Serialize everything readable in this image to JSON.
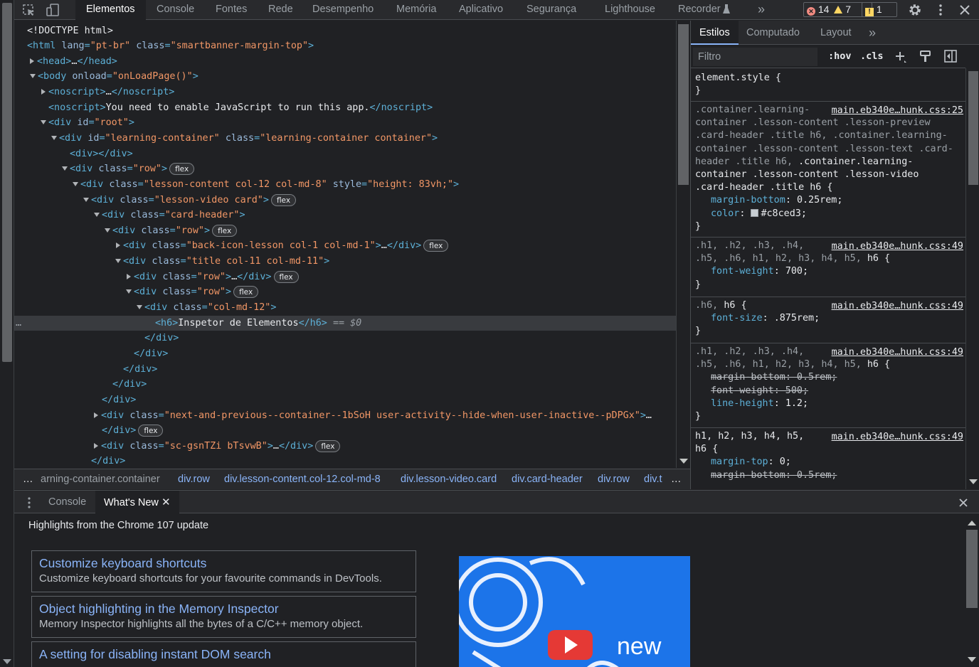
{
  "toolbar": {
    "tabs": [
      "Elementos",
      "Console",
      "Fontes",
      "Rede",
      "Desempenho",
      "Memória",
      "Aplicativo",
      "Segurança",
      "Lighthouse",
      "Recorder"
    ],
    "more": "»",
    "errors": "14",
    "warnings": "7",
    "issues": "1"
  },
  "dom": {
    "lines": [
      {
        "html": "<span class='tx'>&lt;!DOCTYPE html&gt;</span>"
      },
      {
        "html": "<span class='tag'>&lt;html</span> <span class='an'>lang</span><span class='tag'>=</span><span class='av'>\"pt-br\"</span> <span class='an'>class</span><span class='tag'>=</span><span class='av'>\"smartbanner-margin-top\"</span><span class='tag'>&gt;</span>"
      },
      {
        "html": "<span class='tag'>&lt;head&gt;</span><span class='tx'>…</span><span class='tag'>&lt;/head&gt;</span>"
      },
      {
        "html": "<span class='tag'>&lt;body</span> <span class='an'>onload</span><span class='tag'>=</span><span class='av'>\"onLoadPage()\"</span><span class='tag'>&gt;</span>"
      },
      {
        "html": "<span class='tag'>&lt;noscript&gt;</span><span class='tx'>…</span><span class='tag'>&lt;/noscript&gt;</span>"
      },
      {
        "html": "<span class='tag'>&lt;noscript&gt;</span><span class='tx'>You need to enable JavaScript to run this app.</span><span class='tag'>&lt;/noscript&gt;</span>"
      },
      {
        "html": "<span class='tag'>&lt;div</span> <span class='an'>id</span><span class='tag'>=</span><span class='av'>\"root\"</span><span class='tag'>&gt;</span>"
      },
      {
        "html": "<span class='tag'>&lt;div</span> <span class='an'>id</span><span class='tag'>=</span><span class='av'>\"learning-container\"</span> <span class='an'>class</span><span class='tag'>=</span><span class='av'>\"learning-container container\"</span><span class='tag'>&gt;</span>"
      },
      {
        "html": "<span class='tag'>&lt;div&gt;&lt;/div&gt;</span>"
      },
      {
        "html": "<span class='tag'>&lt;div</span> <span class='an'>class</span><span class='tag'>=</span><span class='av'>\"row\"</span><span class='tag'>&gt;</span>"
      },
      {
        "html": "<span class='tag'>&lt;div</span> <span class='an'>class</span><span class='tag'>=</span><span class='av'>\"lesson-content col-12 col-md-8\"</span> <span class='an'>style</span><span class='tag'>=</span><span class='av'>\"height: 83vh;\"</span><span class='tag'>&gt;</span>"
      },
      {
        "html": "<span class='tag'>&lt;div</span> <span class='an'>class</span><span class='tag'>=</span><span class='av'>\"lesson-video card\"</span><span class='tag'>&gt;</span>"
      },
      {
        "html": "<span class='tag'>&lt;div</span> <span class='an'>class</span><span class='tag'>=</span><span class='av'>\"card-header\"</span><span class='tag'>&gt;</span>"
      },
      {
        "html": "<span class='tag'>&lt;div</span> <span class='an'>class</span><span class='tag'>=</span><span class='av'>\"row\"</span><span class='tag'>&gt;</span>"
      },
      {
        "html": "<span class='tag'>&lt;div</span> <span class='an'>class</span><span class='tag'>=</span><span class='av'>\"back-icon-lesson col-1 col-md-1\"</span><span class='tag'>&gt;</span><span class='tx'>…</span><span class='tag'>&lt;/div&gt;</span>"
      },
      {
        "html": "<span class='tag'>&lt;div</span> <span class='an'>class</span><span class='tag'>=</span><span class='av'>\"title col-11 col-md-11\"</span><span class='tag'>&gt;</span>"
      },
      {
        "html": "<span class='tag'>&lt;div</span> <span class='an'>class</span><span class='tag'>=</span><span class='av'>\"row\"</span><span class='tag'>&gt;</span><span class='tx'>…</span><span class='tag'>&lt;/div&gt;</span>"
      },
      {
        "html": "<span class='tag'>&lt;div</span> <span class='an'>class</span><span class='tag'>=</span><span class='av'>\"row\"</span><span class='tag'>&gt;</span>"
      },
      {
        "html": "<span class='tag'>&lt;div</span> <span class='an'>class</span><span class='tag'>=</span><span class='av'>\"col-md-12\"</span><span class='tag'>&gt;</span>"
      },
      {
        "html": "<span class='tag'>&lt;h6&gt;</span><span class='tx'>Inspetor de Elementos</span><span class='tag'>&lt;/h6&gt;</span> <span class='dim'>== <i>$0</i></span>"
      },
      {
        "html": "<span class='tag'>&lt;/div&gt;</span>"
      },
      {
        "html": "<span class='tag'>&lt;/div&gt;</span>"
      },
      {
        "html": "<span class='tag'>&lt;/div&gt;</span>"
      },
      {
        "html": "<span class='tag'>&lt;/div&gt;</span>"
      },
      {
        "html": "<span class='tag'>&lt;/div&gt;</span>"
      },
      {
        "html": "<span class='tag'>&lt;div</span> <span class='an'>class</span><span class='tag'>=</span><span class='av'>\"next-and-previous--container--1bSoH user-activity--hide-when-user-inactive--pDPGx\"</span><span class='tag'>&gt;</span><span class='tx'>…</span>"
      },
      {
        "html": "<span class='tag'>&lt;/div&gt;</span>"
      },
      {
        "html": "<span class='tag'>&lt;div</span> <span class='an'>class</span><span class='tag'>=</span><span class='av'>\"sc-gsnTZi bTsvwB\"</span><span class='tag'>&gt;</span><span class='tx'>…</span><span class='tag'>&lt;/div&gt;</span>"
      },
      {
        "html": "<span class='tag'>&lt;/div&gt;</span>"
      }
    ],
    "flex_badge": "flex",
    "selected_marker": "…"
  },
  "breadcrumbs": [
    "…",
    "arning-container.container",
    "div.row",
    "div.lesson-content.col-12.col-md-8",
    "div.lesson-video.card",
    "div.card-header",
    "div.row",
    "div.t",
    "…"
  ],
  "styles": {
    "tabs": [
      "Estilos",
      "Computado",
      "Layout",
      "»"
    ],
    "filter_placeholder": "Filtro",
    "hov": ":hov",
    "cls": ".cls",
    "element_style": "element.style {",
    "source": "main.eb340e…hunk.css:25",
    "source2": "main.eb340e…hunk.css:49"
  },
  "drawer": {
    "tabs": [
      "Console",
      "What's New"
    ],
    "highlights": "Highlights from the Chrome 107 update",
    "cards": [
      {
        "title": "Customize keyboard shortcuts",
        "desc": "Customize keyboard shortcuts for your favourite commands in DevTools."
      },
      {
        "title": "Object highlighting in the Memory Inspector",
        "desc": "Memory Inspector highlights all the bytes of a C/C++ memory object."
      },
      {
        "title": "A setting for disabling instant DOM search",
        "desc": ""
      }
    ],
    "image_text": "new"
  },
  "colors": {
    "accent": "#8ab4f8",
    "tag": "#5db0d7",
    "attr_value": "#f29766",
    "error": "#f28b82",
    "warning": "#fdd663"
  }
}
